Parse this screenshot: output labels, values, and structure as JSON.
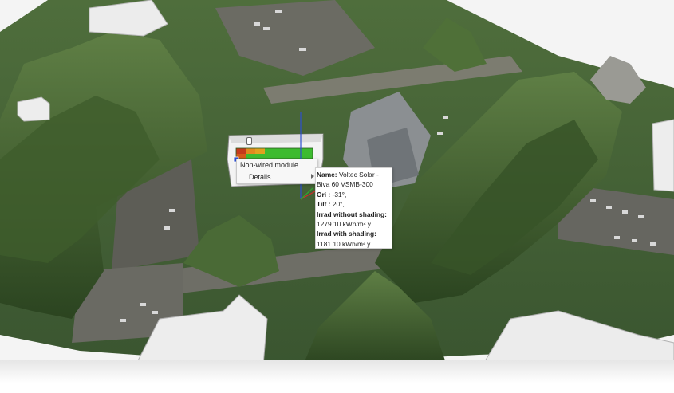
{
  "scene": {
    "colors": {
      "terrain_dark": "#2f4a24",
      "terrain_mid": "#4d6b39",
      "terrain_light": "#6f8f52",
      "road": "#5e5e58",
      "building": "#e9e9e9",
      "panel_green": "#3dbb2f",
      "panel_orange": "#e08a1e",
      "panel_red": "#c43a1c",
      "axis_blue": "#2d4fd0",
      "axis_red": "#d02a2a",
      "axis_green": "#2ea82e"
    }
  },
  "context_menu": {
    "items": [
      {
        "label": "Non-wired module"
      },
      {
        "label": "Details"
      }
    ]
  },
  "details_panel": {
    "name_label": "Name:",
    "name_value_line1": "Voltec Solar -",
    "name_value_line2": "Biva 60 VSMB-300",
    "ori_label": "Ori :",
    "ori_value": "-31°,",
    "tilt_label": "Tilt :",
    "tilt_value": "20°,",
    "irrad_without_label": "Irrad without shading:",
    "irrad_without_value": "1279.10 kWh/m².y",
    "irrad_with_label": "Irrad with shading:",
    "irrad_with_value": "1181.10 kWh/m².y"
  }
}
